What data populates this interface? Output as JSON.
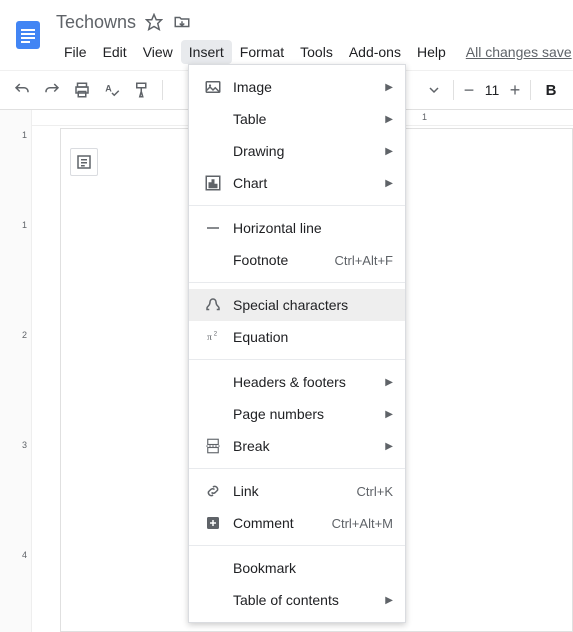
{
  "doc": {
    "title": "Techowns"
  },
  "menubar": {
    "file": "File",
    "edit": "Edit",
    "view": "View",
    "insert": "Insert",
    "format": "Format",
    "tools": "Tools",
    "addons": "Add-ons",
    "help": "Help",
    "changes": "All changes save"
  },
  "toolbar": {
    "font_size": "11",
    "bold": "B"
  },
  "ruler_v": [
    "1",
    "1",
    "2",
    "3",
    "4"
  ],
  "ruler_h": [
    "1"
  ],
  "insert_menu": {
    "image": "Image",
    "table": "Table",
    "drawing": "Drawing",
    "chart": "Chart",
    "hline": "Horizontal line",
    "footnote": "Footnote",
    "footnote_sc": "Ctrl+Alt+F",
    "specialchars": "Special characters",
    "equation": "Equation",
    "headers": "Headers & footers",
    "pagenums": "Page numbers",
    "break": "Break",
    "link": "Link",
    "link_sc": "Ctrl+K",
    "comment": "Comment",
    "comment_sc": "Ctrl+Alt+M",
    "bookmark": "Bookmark",
    "toc": "Table of contents"
  }
}
